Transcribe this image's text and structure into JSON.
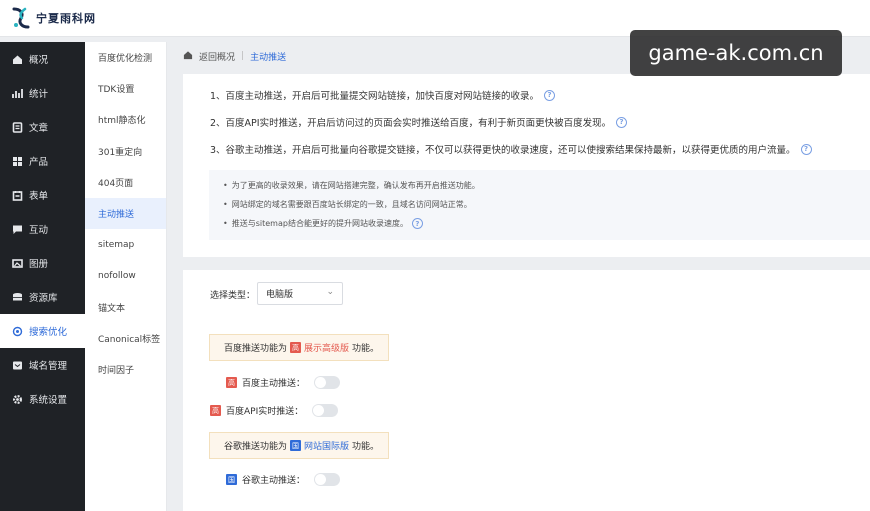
{
  "brand": {
    "name": "宁夏雨科网"
  },
  "watermark": "game-ak.com.cn",
  "sidebar": {
    "items": [
      {
        "label": "概况",
        "icon": "home-icon"
      },
      {
        "label": "统计",
        "icon": "chart-icon"
      },
      {
        "label": "文章",
        "icon": "document-icon"
      },
      {
        "label": "产品",
        "icon": "grid-icon"
      },
      {
        "label": "表单",
        "icon": "form-icon"
      },
      {
        "label": "互动",
        "icon": "chat-icon"
      },
      {
        "label": "图册",
        "icon": "album-icon"
      },
      {
        "label": "资源库",
        "icon": "database-icon"
      },
      {
        "label": "搜索优化",
        "icon": "seo-icon",
        "active": true
      },
      {
        "label": "域名管理",
        "icon": "domain-icon"
      },
      {
        "label": "系统设置",
        "icon": "gear-icon"
      }
    ]
  },
  "subnav": {
    "items": [
      {
        "label": "百度优化检测"
      },
      {
        "label": "TDK设置"
      },
      {
        "label": "html静态化"
      },
      {
        "label": "301重定向"
      },
      {
        "label": "404页面"
      },
      {
        "label": "主动推送",
        "active": true
      },
      {
        "label": "sitemap"
      },
      {
        "label": "nofollow"
      },
      {
        "label": "锚文本"
      },
      {
        "label": "Canonical标签"
      },
      {
        "label": "时间因子"
      }
    ]
  },
  "breadcrumb": {
    "back": "返回概况",
    "separator": "|",
    "current": "主动推送"
  },
  "intro": {
    "lines": [
      "1、百度主动推送，开启后可批量提交网站链接，加快百度对网站链接的收录。",
      "2、百度API实时推送，开启后访问过的页面会实时推送给百度，有利于新页面更快被百度发现。",
      "3、谷歌主动推送，开启后可批量向谷歌提交链接，不仅可以获得更快的收录速度，还可以使搜索结果保持最新，以获得更优质的用户流量。"
    ],
    "notes": [
      "为了更高的收录效果，请在网站搭建完整，确认发布再开启推送功能。",
      "网站绑定的域名需要跟百度站长绑定的一致，且域名访问网站正常。",
      "推送与sitemap结合能更好的提升网站收录速度。"
    ]
  },
  "settings": {
    "select_label": "选择类型：",
    "select_value": "电脑版",
    "baidu_box": {
      "prefix": "百度推送功能为",
      "tag": "高",
      "highlight": "展示高级版",
      "suffix": "功能。"
    },
    "baidu_toggles": [
      {
        "tag": "高",
        "label": "百度主动推送：",
        "on": false
      },
      {
        "tag": "高",
        "label": "百度API实时推送：",
        "on": false
      }
    ],
    "google_box": {
      "prefix": "谷歌推送功能为",
      "tag": "国",
      "highlight": "网站国际版",
      "suffix": "功能。"
    },
    "google_toggles": [
      {
        "tag": "国",
        "label": "谷歌主动推送：",
        "on": false
      }
    ]
  }
}
